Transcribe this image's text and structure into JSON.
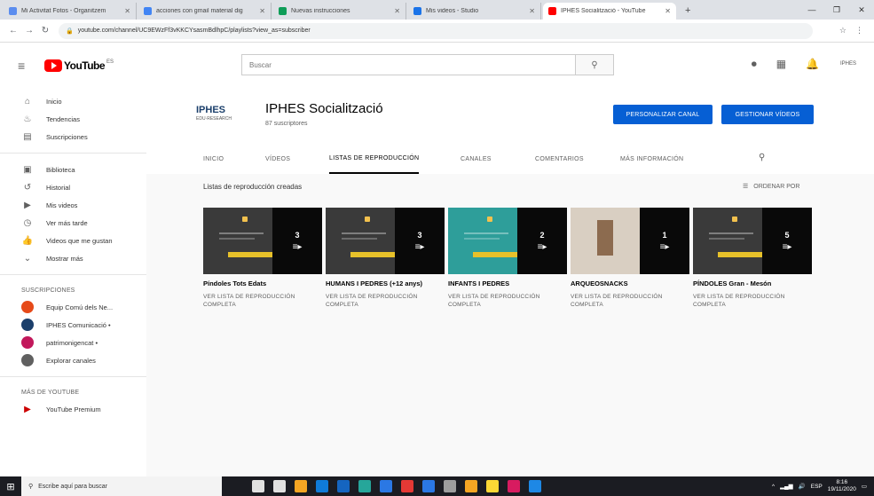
{
  "browser": {
    "tabs": [
      {
        "title": "Mi Activitat Fotos - Organitzem",
        "color": "#5b8def",
        "active": false
      },
      {
        "title": "acciones con gmail material dig",
        "color": "#4285f4",
        "active": false
      },
      {
        "title": "Nuevas instrucciones",
        "color": "#0f9d58",
        "active": false
      },
      {
        "title": "Mis videos - Studio",
        "color": "#1a73e8",
        "active": false
      },
      {
        "title": "IPHES Socialització - YouTube",
        "color": "#ff0000",
        "active": true
      }
    ],
    "new_tab": "+",
    "url": "youtube.com/channel/UC9EWzFf3vKKCYsasmBdlhpC/playlists?view_as=subscriber",
    "window_controls": [
      "—",
      "❐",
      "✕"
    ]
  },
  "masthead": {
    "logo_text": "YouTube",
    "logo_suffix": "ES",
    "search_placeholder": "Buscar",
    "avatar_label": "IPHES"
  },
  "sidebar": {
    "primary": [
      {
        "icon": "home-icon",
        "glyph": "⌂",
        "label": "Inicio"
      },
      {
        "icon": "fire-icon",
        "glyph": "♨",
        "label": "Tendencias"
      },
      {
        "icon": "subscriptions-icon",
        "glyph": "▤",
        "label": "Suscripciones"
      }
    ],
    "library": [
      {
        "icon": "library-icon",
        "glyph": "▣",
        "label": "Biblioteca"
      },
      {
        "icon": "history-icon",
        "glyph": "↺",
        "label": "Historial"
      },
      {
        "icon": "my-videos-icon",
        "glyph": "▶",
        "label": "Mis videos"
      },
      {
        "icon": "watch-later-icon",
        "glyph": "◷",
        "label": "Ver más tarde"
      },
      {
        "icon": "liked-icon",
        "glyph": "👍",
        "label": "Videos que me gustan"
      },
      {
        "icon": "show-more-icon",
        "glyph": "⌄",
        "label": "Mostrar más"
      }
    ],
    "subscriptions_heading": "SUSCRIPCIONES",
    "subscriptions": [
      {
        "label": "Equip Comú dels Ne...",
        "color": "#e64a19"
      },
      {
        "label": "IPHES Comunicació •",
        "color": "#1b3f6b"
      },
      {
        "label": "patrimonigencat  •",
        "color": "#c2185b"
      },
      {
        "label": "Explorar canales",
        "color": "#606060"
      }
    ],
    "more_heading": "MÁS DE YOUTUBE",
    "more": [
      {
        "icon": "premium-icon",
        "glyph": "▶",
        "label": "YouTube Premium"
      }
    ]
  },
  "channel": {
    "logo_main": "IPHES",
    "logo_sub": "EDU·RESEARCH",
    "title": "IPHES Socialització",
    "subscribers": "87 suscriptores",
    "customize_button": "PERSONALIZAR CANAL",
    "manage_button": "GESTIONAR VÍDEOS",
    "tabs": [
      {
        "label": "INICIO",
        "active": false
      },
      {
        "label": "VÍDEOS",
        "active": false
      },
      {
        "label": "LISTAS DE REPRODUCCIÓN",
        "active": true
      },
      {
        "label": "CANALES",
        "active": false
      },
      {
        "label": "COMENTARIOS",
        "active": false
      },
      {
        "label": "MÁS INFORMACIÓN",
        "active": false
      }
    ]
  },
  "playlists": {
    "section_title": "Listas de reproducción creadas",
    "sort_label": "ORDENAR POR",
    "items": [
      {
        "title": "Píndoles Tots Edats",
        "count": "3",
        "thumb": "#3a3a3a",
        "link": "VER LISTA DE REPRODUCCIÓN COMPLETA"
      },
      {
        "title": "HUMANS I PEDRES (+12 anys)",
        "count": "3",
        "thumb": "#3a3a3a",
        "link": "VER LISTA DE REPRODUCCIÓN COMPLETA"
      },
      {
        "title": "INFANTS I PEDRES",
        "count": "2",
        "thumb": "#2e9e9a",
        "link": "VER LISTA DE REPRODUCCIÓN COMPLETA"
      },
      {
        "title": "ARQUEOSNACKS",
        "count": "1",
        "thumb": "#d9cfc2",
        "link": "VER LISTA DE REPRODUCCIÓN COMPLETA"
      },
      {
        "title": "PÍNDOLES Gran - Mesón",
        "count": "5",
        "thumb": "#3a3a3a",
        "link": "VER LISTA DE REPRODUCCIÓN COMPLETA"
      }
    ]
  },
  "taskbar": {
    "search_placeholder": "Escribe aquí para buscar",
    "app_colors": [
      "#e1e1e1",
      "#e1e1e1",
      "#f6a623",
      "#0f7bd8",
      "#1565c0",
      "#26a69a",
      "#2b78e4",
      "#e53935",
      "#2b78e4",
      "#9e9e9e",
      "#f6a623",
      "#fdd835",
      "#d81b60",
      "#1e88e5"
    ],
    "time": "8:16",
    "date": "19/11/2020",
    "lang": "ESP"
  }
}
